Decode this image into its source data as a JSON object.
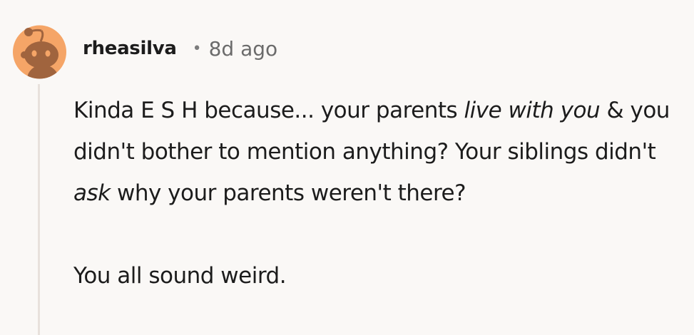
{
  "comment": {
    "username": "rheasilva",
    "separator": "•",
    "timestamp": "8d ago",
    "paragraph1": {
      "s1": "Kinda E S H because... your parents ",
      "s2": "live with you",
      "s3": " & you didn't bother to mention anything? Your siblings didn't ",
      "s4": "ask",
      "s5": " why your parents weren't there?"
    },
    "paragraph2": "You all sound weird."
  },
  "colors": {
    "avatar_bg": "#f5a567",
    "avatar_snoo": "#a0643e",
    "thread_line": "#e8e1dc",
    "background": "#faf8f6"
  },
  "icons": {
    "avatar": "snoo-avatar-icon"
  }
}
